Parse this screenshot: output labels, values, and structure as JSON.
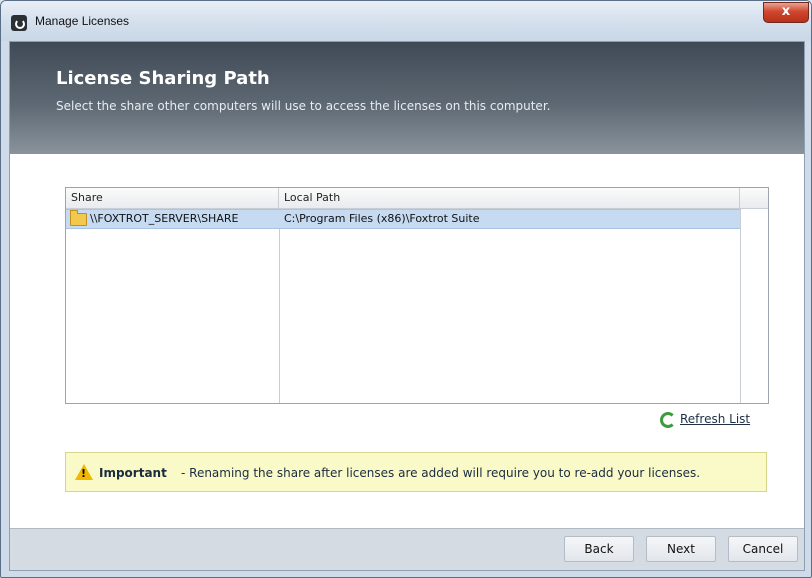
{
  "window": {
    "title": "Manage Licenses",
    "close_glyph": "x"
  },
  "banner": {
    "title": "License Sharing Path",
    "subtitle": "Select the share other computers will use to access the licenses on this computer."
  },
  "grid": {
    "columns": [
      "Share",
      "Local Path"
    ],
    "rows": [
      {
        "share": "\\\\FOXTROT_SERVER\\SHARE",
        "path": "C:\\Program Files (x86)\\Foxtrot Suite",
        "icon": "folder-icon",
        "selected": true
      }
    ]
  },
  "refresh": {
    "label": "Refresh List",
    "icon": "refresh-icon"
  },
  "notice": {
    "strong": "Important",
    "text": "-  Renaming the share after licenses are added will require you to re-add your licenses.",
    "icon": "warning-icon"
  },
  "buttons": {
    "back": "Back",
    "next": "Next",
    "cancel": "Cancel"
  },
  "colors": {
    "selection": "#c6dbf2",
    "notice_bg": "#fafac9",
    "banner_top": "#3f4a56"
  }
}
